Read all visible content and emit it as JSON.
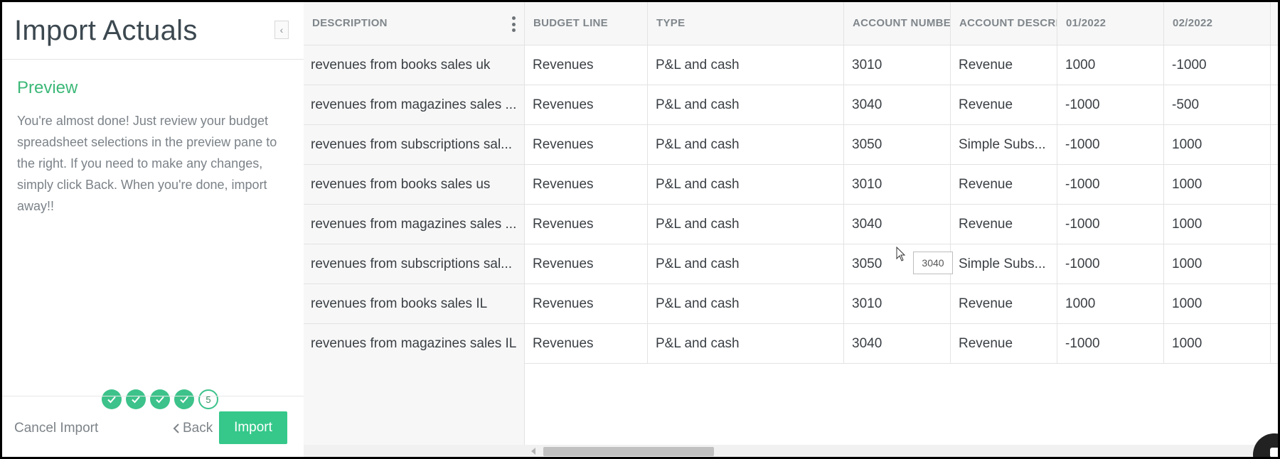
{
  "panel": {
    "title": "Import Actuals",
    "collapse_icon": "chevron-left-icon",
    "preview_heading": "Preview",
    "preview_text": "You're almost done! Just review your budget spreadsheet selections in the preview pane to the right. If you need to make any changes, simply click Back. When you're done, import away!!",
    "steps": [
      "done",
      "done",
      "done",
      "done",
      "5"
    ],
    "cancel_label": "Cancel Import",
    "back_label": "Back",
    "import_label": "Import"
  },
  "colors": {
    "accent": "#35c88a",
    "heading_green": "#3cb878"
  },
  "grid": {
    "columns": [
      "DESCRIPTION",
      "BUDGET LINE",
      "TYPE",
      "ACCOUNT NUMBER",
      "ACCOUNT DESCRIPTION",
      "01/2022",
      "02/2022"
    ],
    "rows": [
      [
        "revenues from books sales uk",
        "Revenues",
        "P&L and cash",
        "3010",
        "Revenue",
        "1000",
        "-1000"
      ],
      [
        "revenues from magazines sales ...",
        "Revenues",
        "P&L and cash",
        "3040",
        "Revenue",
        "-1000",
        "-500"
      ],
      [
        "revenues from subscriptions sal...",
        "Revenues",
        "P&L and cash",
        "3050",
        "Simple Subs...",
        "-1000",
        "1000"
      ],
      [
        "revenues from books sales us",
        "Revenues",
        "P&L and cash",
        "3010",
        "Revenue",
        "-1000",
        "1000"
      ],
      [
        "revenues from magazines sales ...",
        "Revenues",
        "P&L and cash",
        "3040",
        "Revenue",
        "-1000",
        "1000"
      ],
      [
        "revenues from subscriptions sal...",
        "Revenues",
        "P&L and cash",
        "3050",
        "Simple Subs...",
        "-1000",
        "1000"
      ],
      [
        "revenues from books sales IL",
        "Revenues",
        "P&L and cash",
        "3010",
        "Revenue",
        "1000",
        "1000"
      ],
      [
        "revenues from magazines sales IL",
        "Revenues",
        "P&L and cash",
        "3040",
        "Revenue",
        "-1000",
        "1000"
      ]
    ],
    "tooltip": "3040"
  }
}
